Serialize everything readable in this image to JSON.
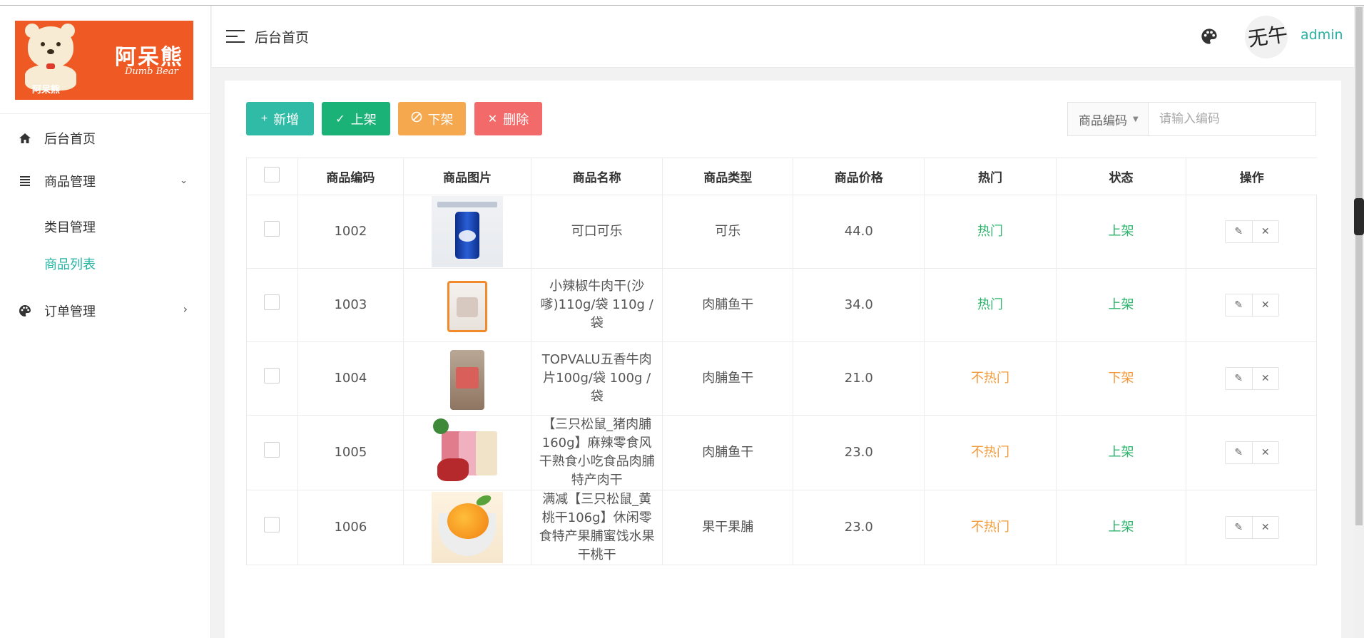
{
  "logo": {
    "brand_cn": "阿呆熊",
    "brand_en": "Dumb Bear",
    "small_cn": "阿呆熊"
  },
  "sidebar": {
    "items": [
      {
        "label": "后台首页",
        "icon": "home-icon"
      },
      {
        "label": "商品管理",
        "icon": "list-icon",
        "expanded": true,
        "children": [
          {
            "label": "类目管理",
            "active": false
          },
          {
            "label": "商品列表",
            "active": true
          }
        ]
      },
      {
        "label": "订单管理",
        "icon": "palette-icon",
        "expanded": false
      }
    ]
  },
  "header": {
    "breadcrumb": "后台首页",
    "username": "admin",
    "avatar_text": "无午"
  },
  "toolbar": {
    "add_label": "新增",
    "up_label": "上架",
    "down_label": "下架",
    "delete_label": "删除"
  },
  "search": {
    "select_value": "商品编码",
    "placeholder": "请输入编码",
    "value": ""
  },
  "table": {
    "columns": [
      "商品编码",
      "商品图片",
      "商品名称",
      "商品类型",
      "商品价格",
      "热门",
      "状态",
      "操作"
    ],
    "rows": [
      {
        "code": "1002",
        "image": "cola",
        "name": "可口可乐",
        "type": "可乐",
        "price": "44.0",
        "hot": "热门",
        "hot_flag": true,
        "status": "上架",
        "status_flag": true
      },
      {
        "code": "1003",
        "image": "beef",
        "name": "小辣椒牛肉干(沙嗲)110g/袋 110g / 袋",
        "type": "肉脯鱼干",
        "price": "34.0",
        "hot": "热门",
        "hot_flag": true,
        "status": "上架",
        "status_flag": true
      },
      {
        "code": "1004",
        "image": "topv",
        "name": "TOPVALU五香牛肉片100g/袋 100g / 袋",
        "type": "肉脯鱼干",
        "price": "21.0",
        "hot": "不热门",
        "hot_flag": false,
        "status": "下架",
        "status_flag": false
      },
      {
        "code": "1005",
        "image": "pork",
        "name": "【三只松鼠_猪肉脯160g】麻辣零食风干熟食小吃食品肉脯特产肉干",
        "type": "肉脯鱼干",
        "price": "23.0",
        "hot": "不热门",
        "hot_flag": false,
        "status": "上架",
        "status_flag": true
      },
      {
        "code": "1006",
        "image": "peach",
        "name": "满减【三只松鼠_黄桃干106g】休闲零食特产果脯蜜饯水果干桃干",
        "type": "果干果脯",
        "price": "23.0",
        "hot": "不热门",
        "hot_flag": false,
        "status": "上架",
        "status_flag": true
      }
    ]
  },
  "colors": {
    "accent": "#26b3a2",
    "add": "#2fbba6",
    "up": "#1ab277",
    "down": "#f5a84e",
    "delete": "#f36a6a",
    "hot": "#2fb46e",
    "cold": "#f59a3a",
    "logo_bg": "#ef5a24"
  }
}
